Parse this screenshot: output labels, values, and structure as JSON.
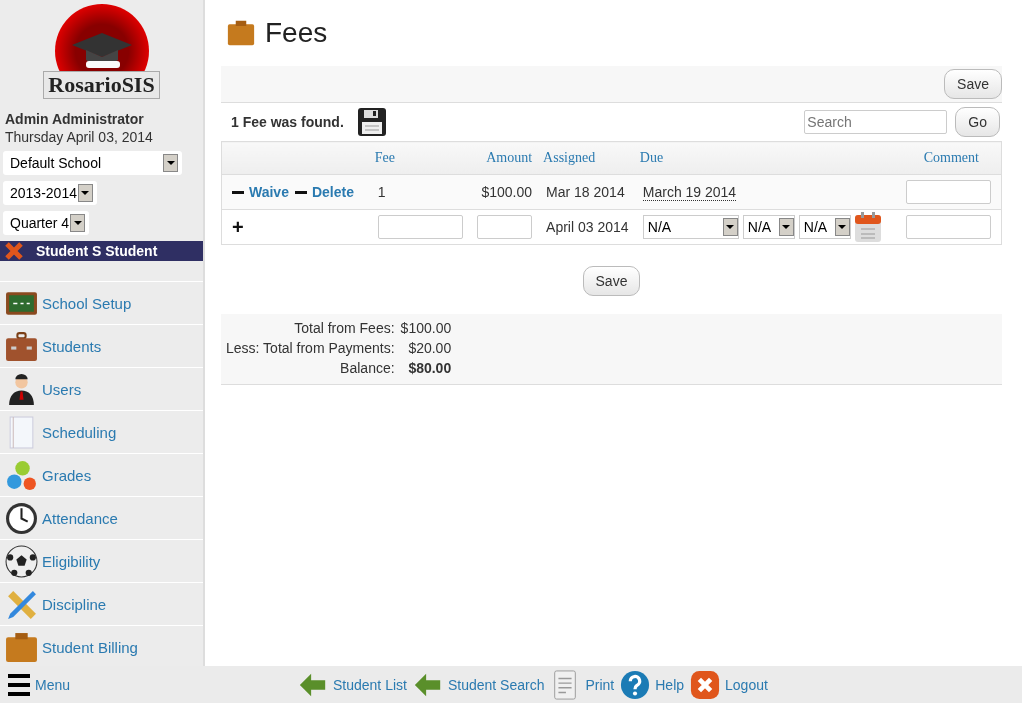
{
  "logo": {
    "text": "RosarioSIS"
  },
  "user": {
    "name": "Admin Administrator",
    "date": "Thursday April 03, 2014"
  },
  "selectors": [
    {
      "value": "Default School"
    },
    {
      "value": "2013-2014"
    },
    {
      "value": "Quarter 4"
    }
  ],
  "current_student": "Student S Student",
  "menu": [
    {
      "label": "School Setup"
    },
    {
      "label": "Students"
    },
    {
      "label": "Users"
    },
    {
      "label": "Scheduling"
    },
    {
      "label": "Grades"
    },
    {
      "label": "Attendance"
    },
    {
      "label": "Eligibility"
    },
    {
      "label": "Discipline"
    },
    {
      "label": "Student Billing"
    }
  ],
  "page_title": "Fees",
  "save_label": "Save",
  "found_text": "1 Fee was found.",
  "search": {
    "placeholder": "Search",
    "button": "Go"
  },
  "table": {
    "columns": [
      "Fee",
      "Amount",
      "Assigned",
      "Due",
      "Comment"
    ],
    "rows": [
      {
        "actions": [
          "Waive",
          "Delete"
        ],
        "fee": "1",
        "amount": "$100.00",
        "assigned": "Mar 18 2014",
        "due": "March 19 2014"
      }
    ],
    "new_row": {
      "add": "+",
      "assigned": "April 03 2014",
      "due_selects": [
        "N/A",
        "N/A",
        "N/A"
      ]
    }
  },
  "bottom_save": "Save",
  "totals": [
    {
      "label": "Total from Fees:",
      "value": "$100.00",
      "bold": false
    },
    {
      "label": "Less: Total from Payments:",
      "value": "$20.00",
      "bold": false
    },
    {
      "label": "Balance:",
      "value": "$80.00",
      "bold": true
    }
  ],
  "footer": {
    "menu": "Menu",
    "links": [
      {
        "label": "Student List"
      },
      {
        "label": "Student Search"
      },
      {
        "label": "Print"
      },
      {
        "label": "Help"
      },
      {
        "label": "Logout"
      }
    ]
  }
}
